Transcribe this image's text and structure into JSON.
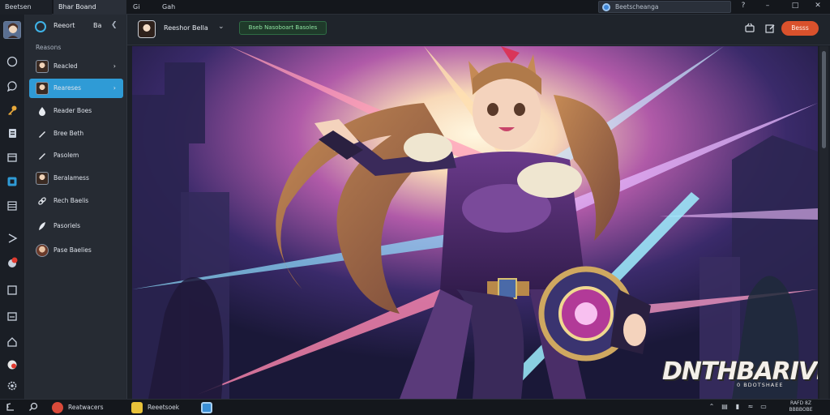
{
  "titlebar": {
    "tabs": [
      "Beetsen",
      "Bhar Boand",
      "Gi",
      "Gah"
    ],
    "search_text": "Beetscheanga",
    "window_buttons": [
      "?",
      "–",
      "□",
      "✕"
    ]
  },
  "sidebar": {
    "app_name": "Reeort",
    "app_count": "Ba",
    "section": "Reasons",
    "items": [
      {
        "label": "Reacled",
        "icon": "avatar-icon",
        "active": false
      },
      {
        "label": "Reareses",
        "icon": "avatar-icon",
        "active": true
      },
      {
        "label": "Reader Boes",
        "icon": "drop-icon",
        "active": false
      },
      {
        "label": "Bree Beth",
        "icon": "pen-icon",
        "active": false
      },
      {
        "label": "Pasolem",
        "icon": "pen-icon",
        "active": false
      },
      {
        "label": "Beralamess",
        "icon": "avatar-icon",
        "active": false
      },
      {
        "label": "Rech Baelis",
        "icon": "link-icon",
        "active": false
      },
      {
        "label": "Pasoriels",
        "icon": "feather-icon",
        "active": false
      },
      {
        "label": "Pase Baelies",
        "icon": "avatar-round-icon",
        "active": false
      }
    ]
  },
  "header": {
    "title": "Reeshor Bella",
    "badge": "Bseb Nasoboart Basoles",
    "button": "Besss"
  },
  "artwork": {
    "title": "DNTHBARIVRE",
    "subtitle": "0 BDOTSHAEE"
  },
  "taskbar": {
    "apps": [
      {
        "label": "Reatwacers",
        "color": "#d94a3a"
      },
      {
        "label": "Reeetsoek",
        "color": "#e8c23a"
      },
      {
        "label": "",
        "color": "#3a8fd6"
      }
    ],
    "clock": [
      "RAFD 8Z",
      "BBBBOBE"
    ]
  },
  "colors": {
    "accent": "#2f9bd6",
    "primary_button": "#d9512c",
    "badge_green": "#8fe3a2"
  }
}
